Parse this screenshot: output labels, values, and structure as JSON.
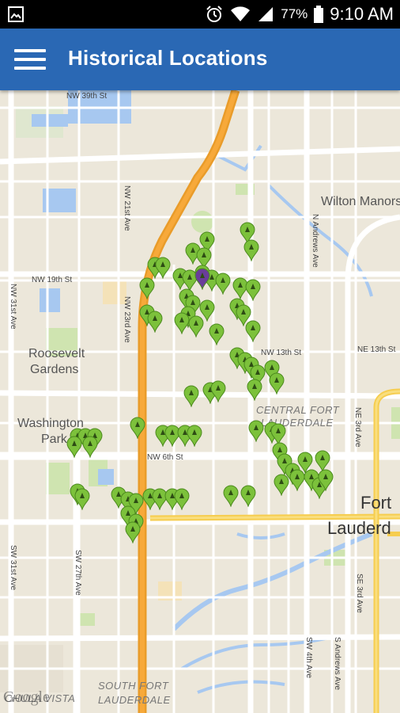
{
  "status_bar": {
    "battery_percent": "77%",
    "time": "9:10 AM",
    "icons": [
      "image-icon",
      "alarm-icon",
      "wifi-icon",
      "signal-icon",
      "battery-icon"
    ]
  },
  "app_bar": {
    "title": "Historical Locations",
    "menu_icon": "hamburger-menu-icon"
  },
  "map": {
    "labels": {
      "wilton_manors": "Wilton Manors",
      "roosevelt": "Roosevelt",
      "gardens": "Gardens",
      "washington": "Washington",
      "park": "Park",
      "central": "CENTRAL FORT",
      "lauderdale_central": "LAUDERDALE",
      "fort": "Fort",
      "lauderd": "Lauderd",
      "south_fort": "SOUTH FORT",
      "lauderdale_south": "LAUDERDALE",
      "chula_vista": "CHULA VISTA",
      "nw19": "NW 19th St",
      "nw13": "NW 13th St",
      "ne13": "NE 13th St",
      "nw6": "NW 6th St",
      "nw39": "NW 39th St",
      "nw21ave": "NW 21st Ave",
      "nw23ave": "NW 23rd Ave",
      "nw31ave": "NW 31st Ave",
      "sw31ave": "SW 31st Ave",
      "sw27ave": "SW 27th Ave",
      "sw4ave": "SW 4th Ave",
      "sandrews": "S Andrews Ave",
      "nandrews": "N Andrews Ave",
      "ne3ave": "NE 3rd Ave",
      "se3ave": "SE 3rd Ave"
    },
    "watermark": "Google",
    "pin_color": "#7cc13b",
    "selected_pin_color": "#6a3d9a"
  }
}
